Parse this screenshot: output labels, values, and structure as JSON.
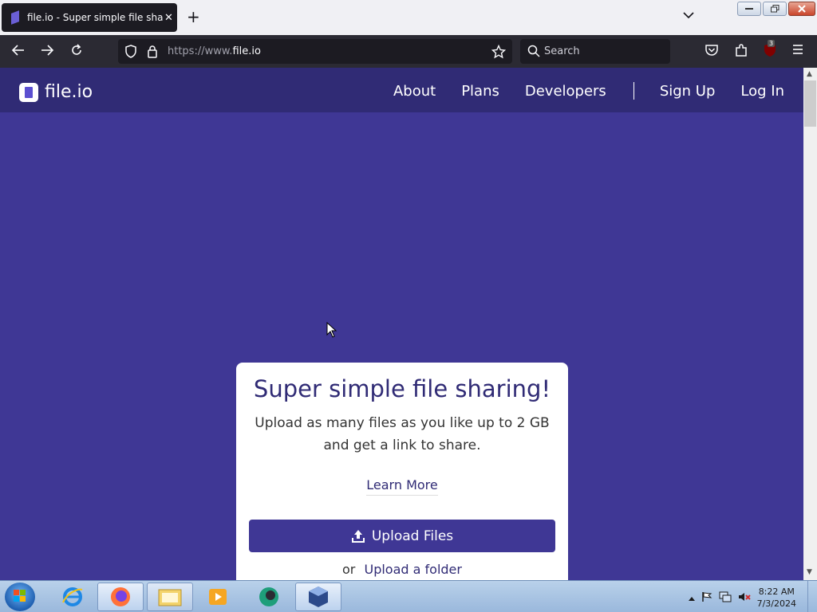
{
  "browser": {
    "tab_title": "file.io - Super simple file sharing",
    "tab_close": "✕",
    "new_tab": "+",
    "url_proto": "https://www.",
    "url_domain": "file.io",
    "search_placeholder": "Search",
    "extension_badge": "3"
  },
  "site": {
    "logo_text": "file.io",
    "nav": {
      "about": "About",
      "plans": "Plans",
      "developers": "Developers",
      "sign_up": "Sign Up",
      "log_in": "Log In"
    }
  },
  "card": {
    "title": "Super simple file sharing!",
    "subtitle": "Upload as many files as you like up to 2 GB and get a link to share.",
    "learn_more": "Learn More",
    "upload_button": "Upload Files",
    "or": "or",
    "upload_folder": "Upload a folder"
  },
  "taskbar": {
    "time": "8:22 AM",
    "date": "7/3/2024"
  },
  "colors": {
    "brand": "#3f3795",
    "brand_dark": "#302b75",
    "card": "#ffffff"
  }
}
